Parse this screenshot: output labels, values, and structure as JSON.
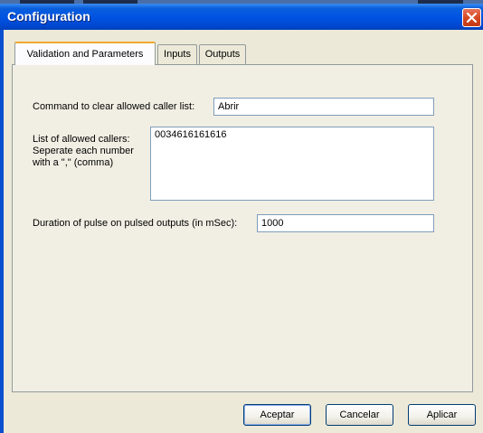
{
  "window": {
    "title": "Configuration",
    "close_icon": "close-icon"
  },
  "tabs": [
    {
      "label": "Validation and Parameters",
      "active": true
    },
    {
      "label": "Inputs",
      "active": false
    },
    {
      "label": "Outputs",
      "active": false
    }
  ],
  "form": {
    "clear_cmd_label": "Command to clear allowed caller list:",
    "clear_cmd_value": "Abrir",
    "callers_label_1": "List of allowed callers:",
    "callers_label_2": "Seperate each number",
    "callers_label_3": "with a \",\" (comma)",
    "callers_value": "0034616161616",
    "pulse_label": "Duration of pulse on pulsed outputs (in mSec):",
    "pulse_value": "1000"
  },
  "buttons": {
    "ok": "Aceptar",
    "cancel": "Cancelar",
    "apply": "Aplicar"
  },
  "colors": {
    "titlebar": "#0054e3",
    "dialog_bg": "#ece9d8",
    "close_button": "#d4451f",
    "tab_highlight": "#f0a830"
  }
}
